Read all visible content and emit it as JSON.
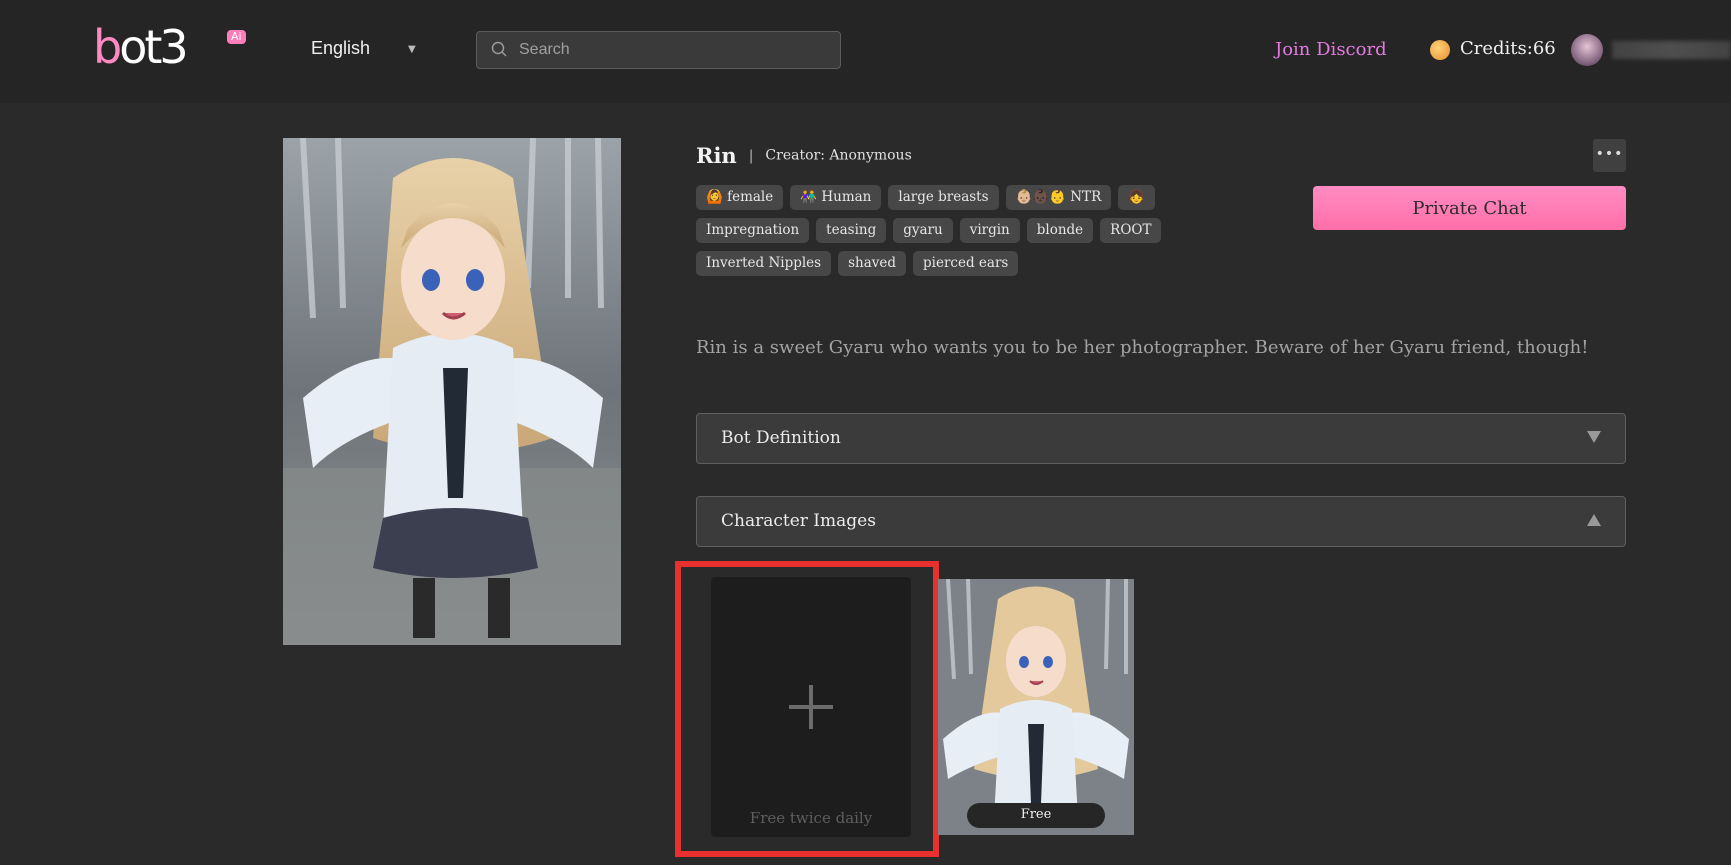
{
  "header": {
    "logo_main": "ot3",
    "logo_prefix": "b",
    "logo_badge": "Ai",
    "language": "English",
    "search_placeholder": "Search",
    "join_discord": "Join Discord",
    "credits": "Credits:66"
  },
  "character": {
    "name": "Rin",
    "separator": "|",
    "creator": "Creator: Anonymous",
    "more_label": "•••",
    "tags": [
      [
        "🙆 female",
        "👫 Human",
        "large breasts",
        "👶🏼👶🏿👶 NTR",
        "👧"
      ],
      [
        "Impregnation",
        "teasing",
        "gyaru",
        "virgin",
        "blonde",
        "ROOT"
      ],
      [
        "Inverted Nipples",
        "shaved",
        "pierced ears"
      ]
    ],
    "private_chat": "Private Chat",
    "description": "Rin is a sweet Gyaru who wants you to be her photographer. Beware of her Gyaru friend, though!"
  },
  "sections": {
    "bot_definition": "Bot Definition",
    "character_images": "Character Images"
  },
  "images": {
    "add_caption": "Free twice daily",
    "thumb_badge": "Free"
  },
  "colors": {
    "accent_pink": "#ff7eb9",
    "discord": "#e47adf",
    "highlight_red": "#e8312f"
  }
}
